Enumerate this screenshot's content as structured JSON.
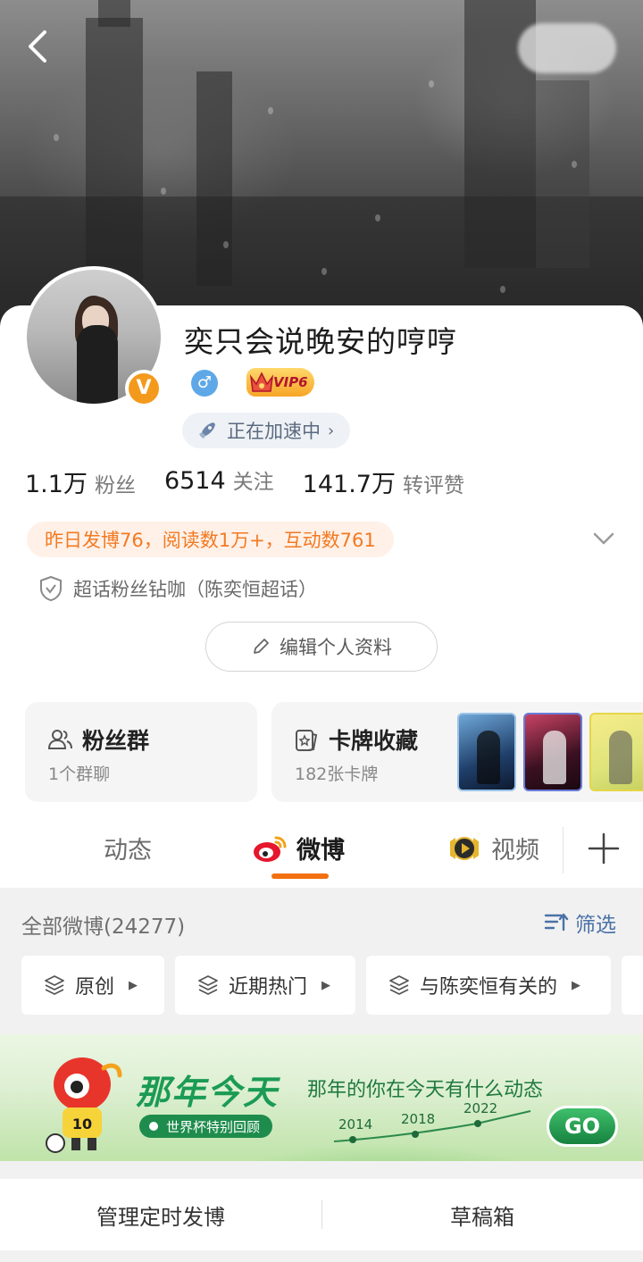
{
  "profile": {
    "username": "奕只会说晚安的哼哼",
    "vip_label": "VIP6",
    "avatar_badge": "V",
    "speed_label": "正在加速中",
    "speed_chevron": "›"
  },
  "stats": [
    {
      "num": "1.1万",
      "label": "粉丝"
    },
    {
      "num": "6514",
      "label": "关注"
    },
    {
      "num": "141.7万",
      "label": "转评赞"
    }
  ],
  "daily_summary": "昨日发博76，阅读数1万+，互动数761",
  "super_topic": "超话粉丝钻咖（陈奕恒超话）",
  "edit_profile_label": "编辑个人资料",
  "tiles": {
    "fans_group": {
      "title": "粉丝群",
      "subtitle": "1个群聊"
    },
    "cards": {
      "title": "卡牌收藏",
      "subtitle": "182张卡牌"
    }
  },
  "tabs": [
    {
      "label": "动态"
    },
    {
      "label": "微博"
    },
    {
      "label": "视频"
    }
  ],
  "feed": {
    "all_weibo_label": "全部微博(24277)",
    "filter_label": "筛选",
    "chips": [
      {
        "label": "原创",
        "arrow": "▶"
      },
      {
        "label": "近期热门",
        "arrow": "▶"
      },
      {
        "label": "与陈奕恒有关的",
        "arrow": "▶"
      }
    ]
  },
  "promo": {
    "title": "那年今天",
    "subtitle": "那年的你在今天有什么动态",
    "badge": "世界杯特别回顾",
    "years": [
      "2014",
      "2018",
      "2022"
    ],
    "go_label": "GO",
    "mascot_number": "10"
  },
  "bottom_bar": {
    "scheduled": "管理定时发博",
    "drafts": "草稿箱"
  },
  "colors": {
    "accent_orange": "#f2700f",
    "link_blue": "#4b72a8",
    "promo_green": "#1b9b54"
  }
}
